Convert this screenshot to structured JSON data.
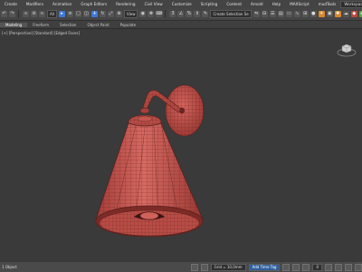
{
  "menu": {
    "items": [
      "Create",
      "Modifiers",
      "Animation",
      "Graph Editors",
      "Rendering",
      "Civil View",
      "Customize",
      "Scripting",
      "Content",
      "Arnold",
      "Help",
      "MAXScript",
      "mudTools"
    ],
    "workspace": "Workspaces: Default"
  },
  "toolbar": {
    "selection_filter": "All",
    "view_dropdown": "View",
    "named_selection": "Create Selection Se"
  },
  "ribbon": {
    "tabs": [
      "Modeling",
      "Freeform",
      "Selection",
      "Object Paint",
      "Populate"
    ]
  },
  "viewport": {
    "label": "[+] [Perspective] [Standard] [Edged Faces]",
    "mesh_color": "#c9534e",
    "wire_color": "#5a1f1c"
  },
  "status": {
    "left_text": "1 Object",
    "grid": "Grid = 10,0mm",
    "add_time_tag": "Add Time Tag",
    "frame": "0"
  }
}
